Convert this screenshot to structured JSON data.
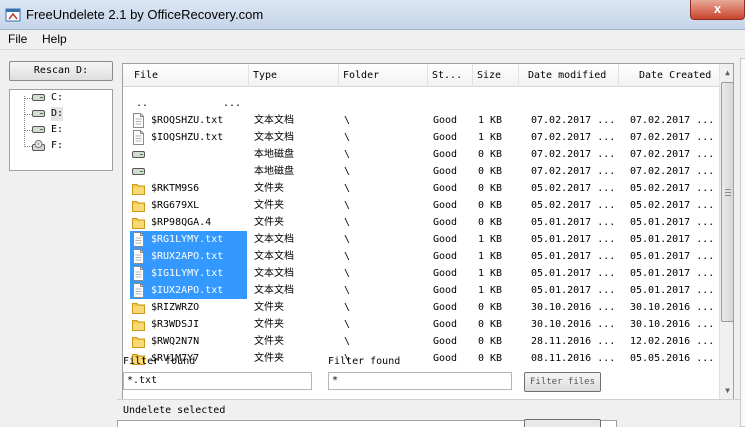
{
  "window": {
    "title": "FreeUndelete 2.1 by OfficeRecovery.com",
    "close_label": "x"
  },
  "menu": [
    {
      "label": "File"
    },
    {
      "label": "Help"
    }
  ],
  "left": {
    "rescan_label": "Rescan D:",
    "drives": [
      {
        "label": "C:"
      },
      {
        "label": "D:"
      },
      {
        "label": "E:"
      },
      {
        "label": "F:"
      }
    ]
  },
  "columns": [
    {
      "label": "File"
    },
    {
      "label": "Type"
    },
    {
      "label": "Folder"
    },
    {
      "label": "St..."
    },
    {
      "label": "Size"
    },
    {
      "label": "Date modified"
    },
    {
      "label": "Date Created"
    }
  ],
  "rows": [
    {
      "icon": "none",
      "name": "..",
      "type": "",
      "folder": "...",
      "status": "",
      "size": "",
      "modified": "",
      "created": "",
      "selected": false
    },
    {
      "icon": "file",
      "name": "$ROQSHZU.txt",
      "type": "文本文档",
      "folder": "\\",
      "status": "Good",
      "size": "1 KB",
      "modified": "07.02.2017 ...",
      "created": "07.02.2017 ...",
      "selected": false
    },
    {
      "icon": "file",
      "name": "$IOQSHZU.txt",
      "type": "文本文档",
      "folder": "\\",
      "status": "Good",
      "size": "1 KB",
      "modified": "07.02.2017 ...",
      "created": "07.02.2017 ...",
      "selected": false
    },
    {
      "icon": "drive",
      "name": "",
      "type": "本地磁盘",
      "folder": "\\",
      "status": "Good",
      "size": "0 KB",
      "modified": "07.02.2017 ...",
      "created": "07.02.2017 ...",
      "selected": false
    },
    {
      "icon": "drive",
      "name": "",
      "type": "本地磁盘",
      "folder": "\\",
      "status": "Good",
      "size": "0 KB",
      "modified": "07.02.2017 ...",
      "created": "07.02.2017 ...",
      "selected": false
    },
    {
      "icon": "folder",
      "name": "$RKTM9S6",
      "type": "文件夹",
      "folder": "\\",
      "status": "Good",
      "size": "0 KB",
      "modified": "05.02.2017 ...",
      "created": "05.02.2017 ...",
      "selected": false
    },
    {
      "icon": "folder",
      "name": "$RG679XL",
      "type": "文件夹",
      "folder": "\\",
      "status": "Good",
      "size": "0 KB",
      "modified": "05.02.2017 ...",
      "created": "05.02.2017 ...",
      "selected": false
    },
    {
      "icon": "folder",
      "name": "$RP98QGA.4",
      "type": "文件夹",
      "folder": "\\",
      "status": "Good",
      "size": "0 KB",
      "modified": "05.01.2017 ...",
      "created": "05.01.2017 ...",
      "selected": false
    },
    {
      "icon": "file",
      "name": "$RG1LYMY.txt",
      "type": "文本文档",
      "folder": "\\",
      "status": "Good",
      "size": "1 KB",
      "modified": "05.01.2017 ...",
      "created": "05.01.2017 ...",
      "selected": true
    },
    {
      "icon": "file",
      "name": "$RUX2APO.txt",
      "type": "文本文档",
      "folder": "\\",
      "status": "Good",
      "size": "1 KB",
      "modified": "05.01.2017 ...",
      "created": "05.01.2017 ...",
      "selected": true
    },
    {
      "icon": "file",
      "name": "$IG1LYMY.txt",
      "type": "文本文档",
      "folder": "\\",
      "status": "Good",
      "size": "1 KB",
      "modified": "05.01.2017 ...",
      "created": "05.01.2017 ...",
      "selected": true
    },
    {
      "icon": "file",
      "name": "$IUX2APO.txt",
      "type": "文本文档",
      "folder": "\\",
      "status": "Good",
      "size": "1 KB",
      "modified": "05.01.2017 ...",
      "created": "05.01.2017 ...",
      "selected": true
    },
    {
      "icon": "folder",
      "name": "$RIZWRZO",
      "type": "文件夹",
      "folder": "\\",
      "status": "Good",
      "size": "0 KB",
      "modified": "30.10.2016 ...",
      "created": "30.10.2016 ...",
      "selected": false
    },
    {
      "icon": "folder",
      "name": "$R3WDSJI",
      "type": "文件夹",
      "folder": "\\",
      "status": "Good",
      "size": "0 KB",
      "modified": "30.10.2016 ...",
      "created": "30.10.2016 ...",
      "selected": false
    },
    {
      "icon": "folder",
      "name": "$RWQ2N7N",
      "type": "文件夹",
      "folder": "\\",
      "status": "Good",
      "size": "0 KB",
      "modified": "28.11.2016 ...",
      "created": "12.02.2016 ...",
      "selected": false
    },
    {
      "icon": "folder",
      "name": "$RV1M7Y7",
      "type": "文件夹",
      "folder": "\\",
      "status": "Good",
      "size": "0 KB",
      "modified": "08.11.2016 ...",
      "created": "05.05.2016 ...",
      "selected": false
    }
  ],
  "filters": {
    "label1": "Filter found",
    "value1": "*.txt",
    "label2": "Filter found",
    "value2": "*",
    "button_label": "Filter files"
  },
  "undelete": {
    "label": "Undelete selected"
  }
}
